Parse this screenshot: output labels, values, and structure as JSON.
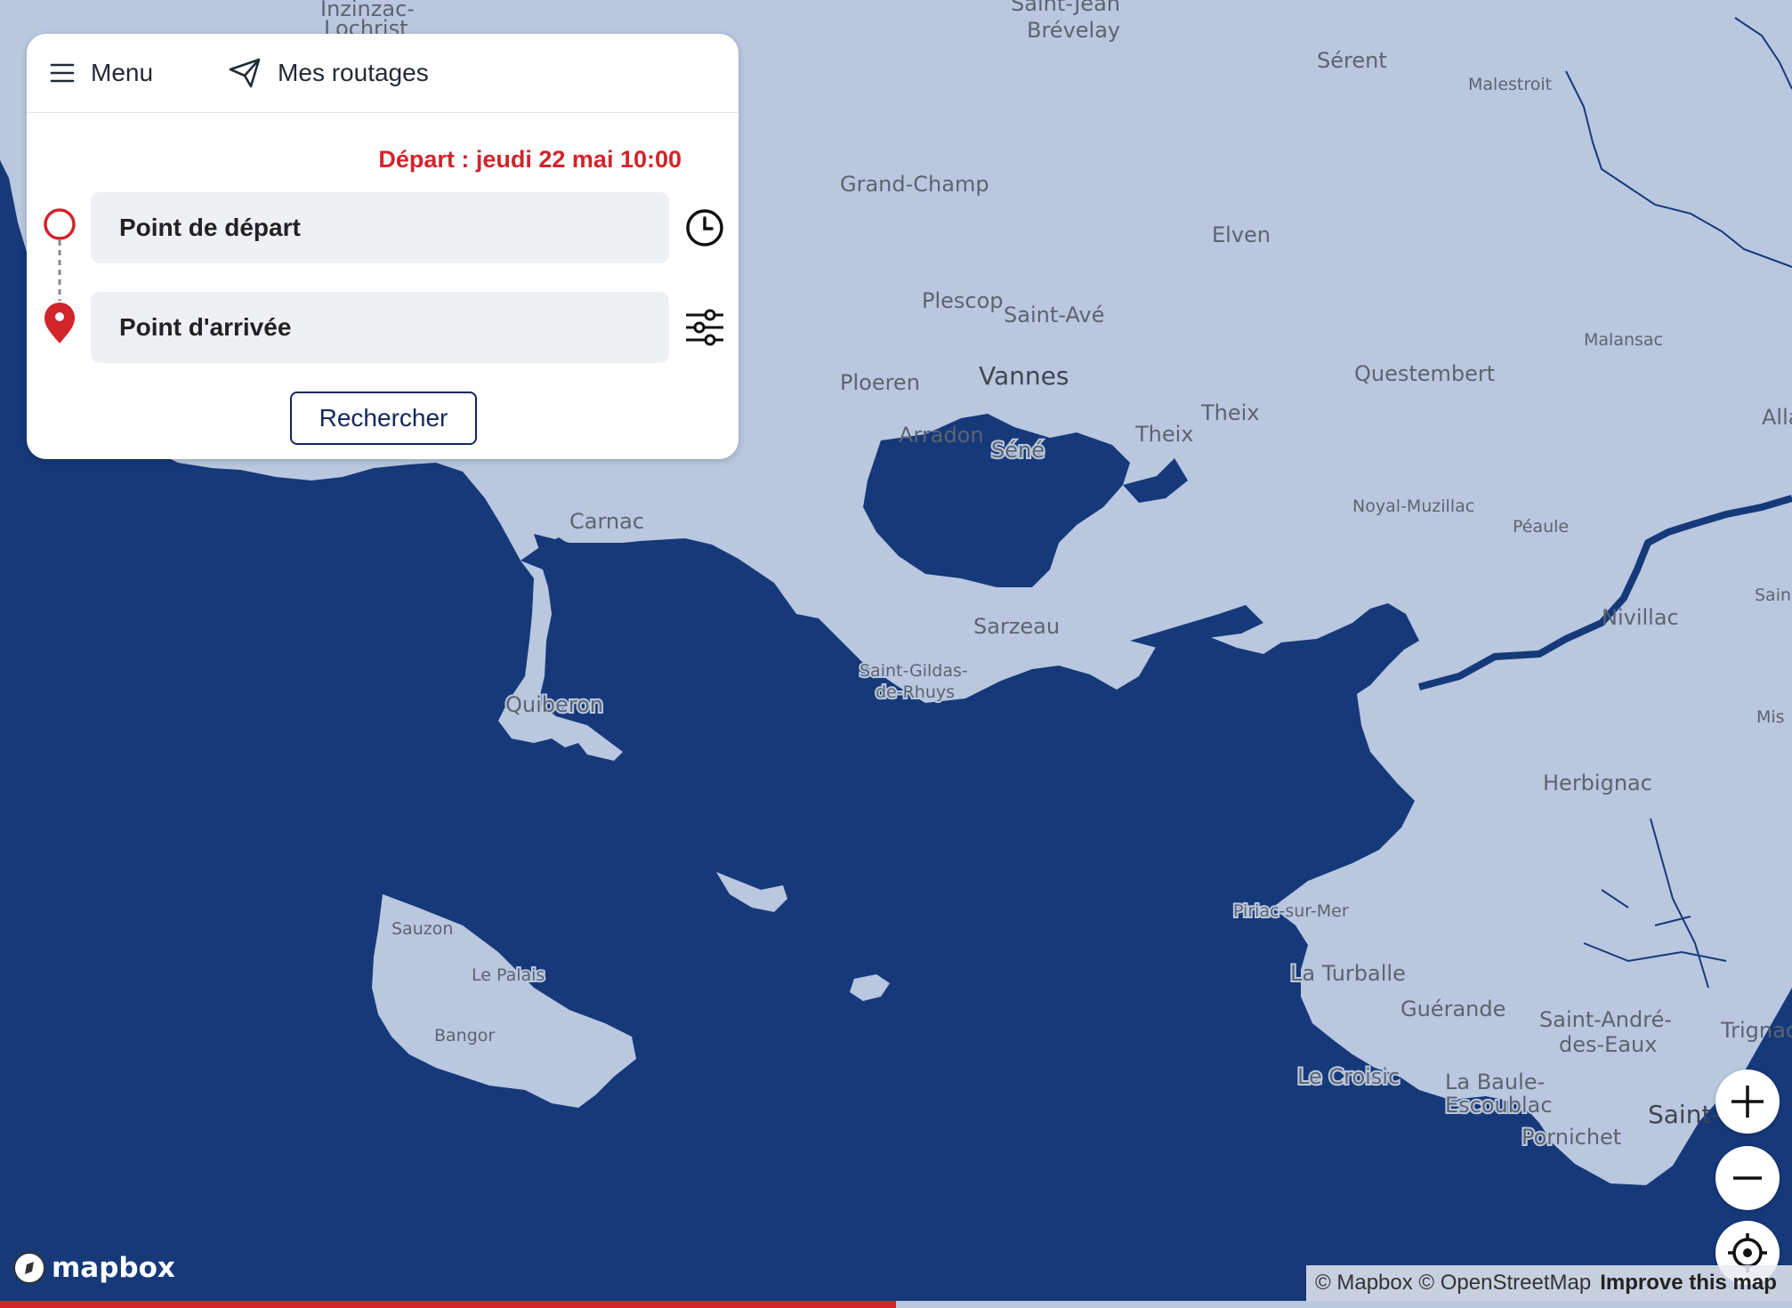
{
  "header": {
    "menu_label": "Menu",
    "routes_label": "Mes routages"
  },
  "route_form": {
    "departure_info": "Départ : jeudi 22 mai 10:00",
    "start_placeholder": "Point de départ",
    "end_placeholder": "Point d'arrivée",
    "search_label": "Rechercher"
  },
  "map": {
    "colors": {
      "sea": "#16397a",
      "land": "#b9c7df",
      "accent": "#d2242b"
    },
    "places": {
      "inzinzac": "Inzinzac-",
      "lochrist": "Lochrist",
      "saint_jean": "Saint-Jean",
      "brevelay": "Brévelay",
      "serent": "Sérent",
      "malestroit": "Malestroit",
      "grand_champ": "Grand-Champ",
      "elven": "Elven",
      "plescop": "Plescop",
      "saint_ave": "Saint-Avé",
      "malansac": "Malansac",
      "ploeren": "Ploeren",
      "vannes": "Vannes",
      "questembert": "Questembert",
      "theix": "Theix",
      "allaire": "Alla",
      "arradon": "Arradon",
      "sene": "Séné",
      "noyal": "Noyal-Muzillac",
      "peaule": "Péaule",
      "carnac": "Carnac",
      "saint_partial": "Sain",
      "sarzeau": "Sarzeau",
      "nivillac": "Nivillac",
      "gildas_1": "Saint-Gildas-",
      "gildas_2": "de-Rhuys",
      "quiberon": "Quiberon",
      "missillac": "Mis",
      "herbignac": "Herbignac",
      "sauzon": "Sauzon",
      "piriac": "Piriac-sur-Mer",
      "le_palais": "Le Palais",
      "la_turballe": "La Turballe",
      "guerande": "Guérande",
      "saint_andre_1": "Saint-André-",
      "saint_andre_2": "des-Eaux",
      "trignac": "Trignac",
      "bangor": "Bangor",
      "le_croisic": "Le Croisic",
      "la_baule_1": "La Baule-",
      "la_baule_2": "Escoublac",
      "saint_nazaire": "Saint-N",
      "pornichet": "Pornichet"
    }
  },
  "controls": {
    "zoom_in": "plus-icon",
    "zoom_out": "minus-icon",
    "locate": "crosshair-icon"
  },
  "attribution": {
    "mapbox": "© Mapbox",
    "osm": "© OpenStreetMap",
    "improve": "Improve this map"
  },
  "logo_text": "mapbox",
  "progress": {
    "percent": 50
  }
}
